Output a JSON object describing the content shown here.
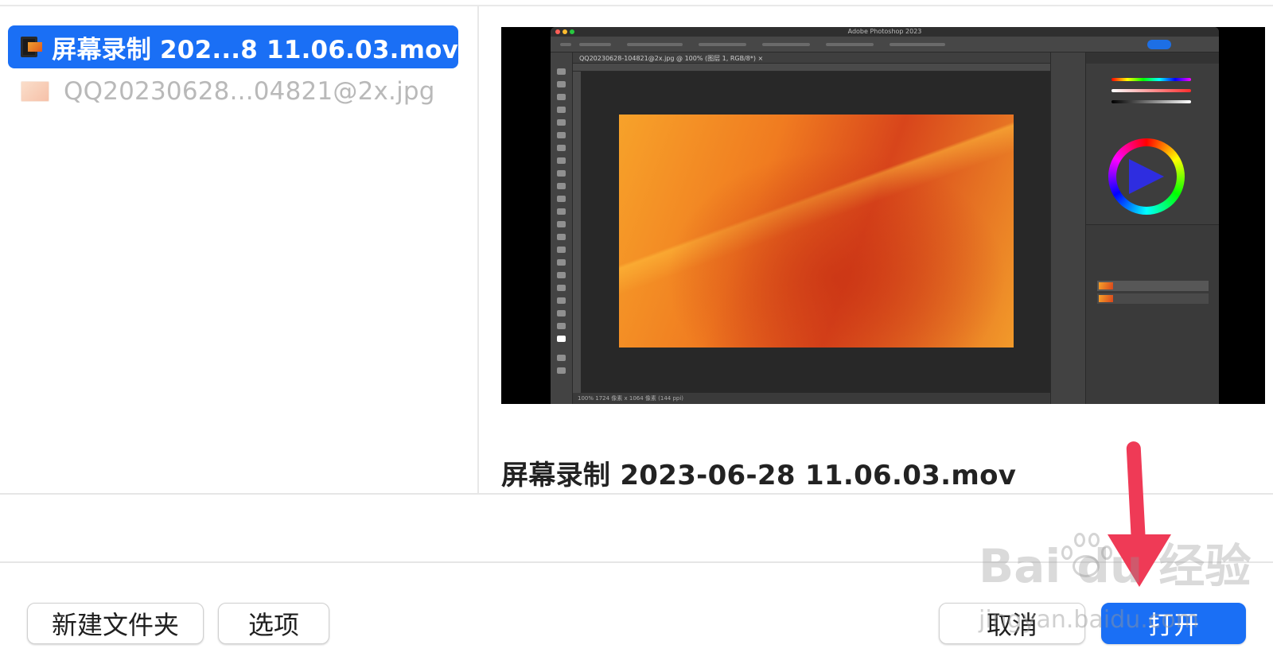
{
  "file_list": {
    "items": [
      {
        "name": "屏幕录制 202...8 11.06.03.mov",
        "selected": true,
        "icon": "video-file-icon"
      },
      {
        "name": "QQ20230628...04821@2x.jpg",
        "selected": false,
        "icon": "image-file-icon"
      }
    ]
  },
  "preview": {
    "app_title": "Adobe Photoshop 2023",
    "doc_tab": "QQ20230628-104821@2x.jpg @ 100% (图层 1, RGB/8*) ×",
    "status": "100%   1724 像素 x 1064 像素 (144 ppi)",
    "caption": "屏幕录制 2023-06-28 11.06.03.mov"
  },
  "buttons": {
    "new_folder": "新建文件夹",
    "options": "选项",
    "cancel": "取消",
    "open": "打开"
  },
  "watermark": {
    "logo_text": "Bai du 经验",
    "url": "jingyan.baidu.com"
  },
  "colors": {
    "accent": "#1a6ff5",
    "arrow": "#ef3a56"
  }
}
